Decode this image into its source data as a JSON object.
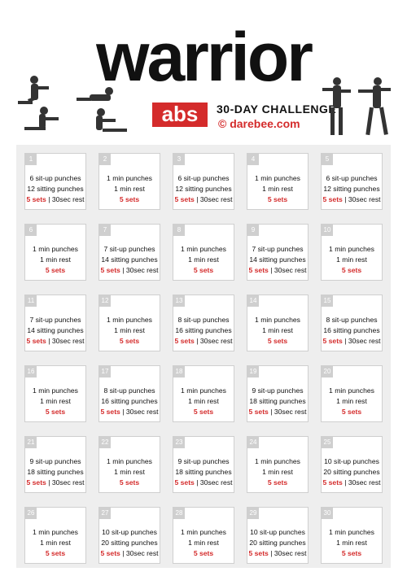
{
  "header": {
    "title": "warrior",
    "badge": "abs",
    "subtitle": "30-DAY CHALLENGE",
    "brand": "© darebee.com"
  },
  "days": [
    {
      "num": "1",
      "lines": [
        "6 sit-up punches",
        "12 sitting punches"
      ],
      "sets": "5 sets",
      "rest": "30sec rest"
    },
    {
      "num": "2",
      "lines": [
        "1 min punches",
        "1 min rest"
      ],
      "sets": "5 sets",
      "rest": ""
    },
    {
      "num": "3",
      "lines": [
        "6 sit-up punches",
        "12 sitting punches"
      ],
      "sets": "5 sets",
      "rest": "30sec rest"
    },
    {
      "num": "4",
      "lines": [
        "1 min punches",
        "1 min rest"
      ],
      "sets": "5 sets",
      "rest": ""
    },
    {
      "num": "5",
      "lines": [
        "6 sit-up punches",
        "12 sitting punches"
      ],
      "sets": "5 sets",
      "rest": "30sec rest"
    },
    {
      "num": "6",
      "lines": [
        "1 min punches",
        "1 min rest"
      ],
      "sets": "5 sets",
      "rest": ""
    },
    {
      "num": "7",
      "lines": [
        "7 sit-up punches",
        "14 sitting punches"
      ],
      "sets": "5 sets",
      "rest": "30sec rest"
    },
    {
      "num": "8",
      "lines": [
        "1 min punches",
        "1 min rest"
      ],
      "sets": "5 sets",
      "rest": ""
    },
    {
      "num": "9",
      "lines": [
        "7 sit-up punches",
        "14 sitting punches"
      ],
      "sets": "5 sets",
      "rest": "30sec rest"
    },
    {
      "num": "10",
      "lines": [
        "1 min punches",
        "1 min rest"
      ],
      "sets": "5 sets",
      "rest": ""
    },
    {
      "num": "11",
      "lines": [
        "7 sit-up punches",
        "14 sitting punches"
      ],
      "sets": "5 sets",
      "rest": "30sec rest"
    },
    {
      "num": "12",
      "lines": [
        "1 min punches",
        "1 min rest"
      ],
      "sets": "5 sets",
      "rest": ""
    },
    {
      "num": "13",
      "lines": [
        "8 sit-up punches",
        "16 sitting punches"
      ],
      "sets": "5 sets",
      "rest": "30sec rest"
    },
    {
      "num": "14",
      "lines": [
        "1 min punches",
        "1 min rest"
      ],
      "sets": "5 sets",
      "rest": ""
    },
    {
      "num": "15",
      "lines": [
        "8 sit-up punches",
        "16 sitting punches"
      ],
      "sets": "5 sets",
      "rest": "30sec rest"
    },
    {
      "num": "16",
      "lines": [
        "1 min punches",
        "1 min rest"
      ],
      "sets": "5 sets",
      "rest": ""
    },
    {
      "num": "17",
      "lines": [
        "8 sit-up punches",
        "16 sitting punches"
      ],
      "sets": "5 sets",
      "rest": "30sec rest"
    },
    {
      "num": "18",
      "lines": [
        "1 min punches",
        "1 min rest"
      ],
      "sets": "5 sets",
      "rest": ""
    },
    {
      "num": "19",
      "lines": [
        "9 sit-up punches",
        "18 sitting punches"
      ],
      "sets": "5 sets",
      "rest": "30sec rest"
    },
    {
      "num": "20",
      "lines": [
        "1 min punches",
        "1 min rest"
      ],
      "sets": "5 sets",
      "rest": ""
    },
    {
      "num": "21",
      "lines": [
        "9 sit-up punches",
        "18 sitting punches"
      ],
      "sets": "5 sets",
      "rest": "30sec rest"
    },
    {
      "num": "22",
      "lines": [
        "1 min punches",
        "1 min rest"
      ],
      "sets": "5 sets",
      "rest": ""
    },
    {
      "num": "23",
      "lines": [
        "9 sit-up punches",
        "18 sitting punches"
      ],
      "sets": "5 sets",
      "rest": "30sec rest"
    },
    {
      "num": "24",
      "lines": [
        "1 min punches",
        "1 min rest"
      ],
      "sets": "5 sets",
      "rest": ""
    },
    {
      "num": "25",
      "lines": [
        "10 sit-up punches",
        "20 sitting punches"
      ],
      "sets": "5 sets",
      "rest": "30sec rest"
    },
    {
      "num": "26",
      "lines": [
        "1 min punches",
        "1 min rest"
      ],
      "sets": "5 sets",
      "rest": ""
    },
    {
      "num": "27",
      "lines": [
        "10 sit-up punches",
        "20 sitting punches"
      ],
      "sets": "5 sets",
      "rest": "30sec rest"
    },
    {
      "num": "28",
      "lines": [
        "1 min punches",
        "1 min rest"
      ],
      "sets": "5 sets",
      "rest": ""
    },
    {
      "num": "29",
      "lines": [
        "10 sit-up punches",
        "20 sitting punches"
      ],
      "sets": "5 sets",
      "rest": "30sec rest"
    },
    {
      "num": "30",
      "lines": [
        "1 min punches",
        "1 min rest"
      ],
      "sets": "5 sets",
      "rest": ""
    }
  ],
  "colors": {
    "accent": "#d42b2b",
    "cell_border": "#cfcfcf",
    "grid_bg": "#eeeeee"
  }
}
